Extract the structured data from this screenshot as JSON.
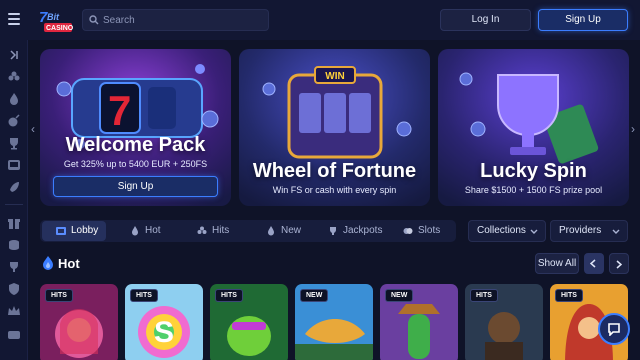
{
  "header": {
    "logo": "7Bit Casino",
    "search_placeholder": "Search",
    "login_label": "Log In",
    "signup_label": "Sign Up"
  },
  "banners": [
    {
      "title": "Welcome Pack",
      "subtitle": "Get 325% up to 5400 EUR + 250FS",
      "button": "Sign Up"
    },
    {
      "title": "Wheel of Fortune",
      "subtitle": "Win FS or cash with every spin",
      "art_text": "WIN"
    },
    {
      "title": "Lucky Spin",
      "subtitle": "Share $1500 + 1500 FS prize pool"
    }
  ],
  "tabs": [
    {
      "label": "Lobby",
      "icon": "lobby-icon",
      "active": true
    },
    {
      "label": "Hot",
      "icon": "flame-icon"
    },
    {
      "label": "Hits",
      "icon": "clover-icon"
    },
    {
      "label": "New",
      "icon": "fire-icon"
    },
    {
      "label": "Jackpots",
      "icon": "trophy-icon"
    },
    {
      "label": "Slots",
      "icon": "slots-icon"
    }
  ],
  "filters": {
    "collections": "Collections",
    "providers": "Providers"
  },
  "hot_section": {
    "title": "Hot",
    "show_all": "Show All"
  },
  "games": [
    {
      "badge": "HITS"
    },
    {
      "badge": "HITS",
      "art_text": "S"
    },
    {
      "badge": "HITS"
    },
    {
      "badge": "NEW"
    },
    {
      "badge": "NEW"
    },
    {
      "badge": "HITS"
    },
    {
      "badge": "HITS"
    }
  ],
  "colors": {
    "background": "#0f1328",
    "accent": "#3b7dff",
    "panel": "#171d3c"
  }
}
